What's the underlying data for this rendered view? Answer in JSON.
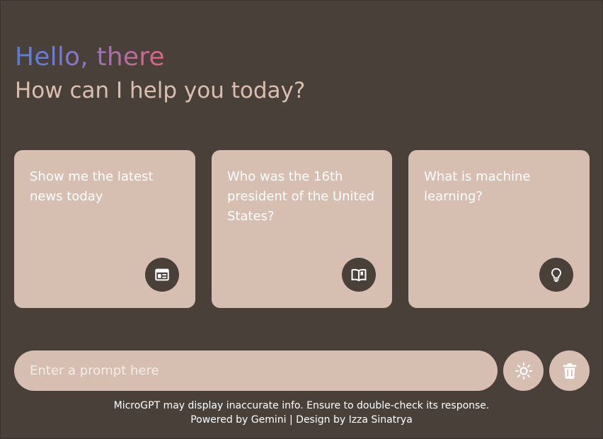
{
  "header": {
    "greeting": "Hello, there",
    "subtitle": "How can I help you today?"
  },
  "suggestions": [
    {
      "text": "Show me the latest news today",
      "icon": "newspaper-icon"
    },
    {
      "text": "Who was the 16th president of the United States?",
      "icon": "book-icon"
    },
    {
      "text": "What is machine learning?",
      "icon": "lightbulb-icon"
    }
  ],
  "prompt": {
    "placeholder": "Enter a prompt here",
    "value": ""
  },
  "actions": {
    "theme_icon": "sun-icon",
    "delete_icon": "trash-icon"
  },
  "footer": {
    "disclaimer": "MicroGPT may display inaccurate info. Ensure to double-check its response.",
    "credits": "Powered by Gemini | Design by Izza Sinatrya"
  },
  "colors": {
    "background": "#4a403a",
    "card": "#d6bfb1",
    "gradient_start": "#4f7fe0",
    "gradient_end": "#d6677c",
    "text_light": "#ffffff"
  }
}
